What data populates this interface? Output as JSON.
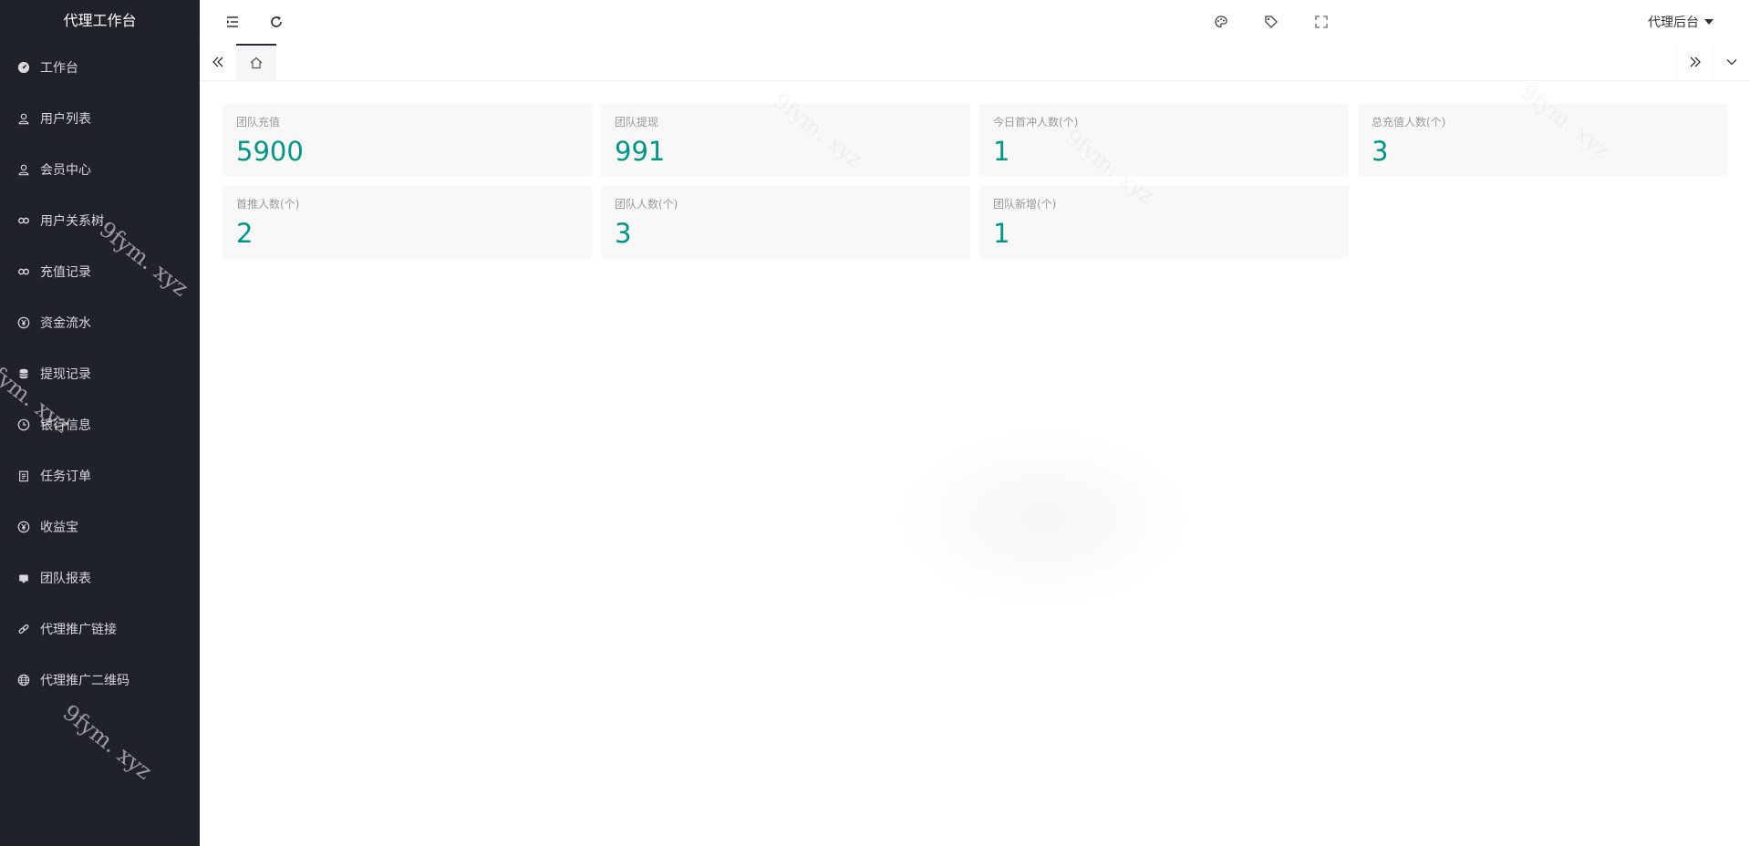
{
  "sidebar": {
    "title": "代理工作台",
    "items": [
      {
        "label": "工作台",
        "icon": "dashboard-icon"
      },
      {
        "label": "用户列表",
        "icon": "user-icon"
      },
      {
        "label": "会员中心",
        "icon": "user-icon"
      },
      {
        "label": "用户关系树",
        "icon": "link-chain-icon"
      },
      {
        "label": "充值记录",
        "icon": "link-chain-icon"
      },
      {
        "label": "资金流水",
        "icon": "yen-circle-icon"
      },
      {
        "label": "提现记录",
        "icon": "database-icon"
      },
      {
        "label": "银行信息",
        "icon": "clock-icon"
      },
      {
        "label": "任务订单",
        "icon": "clipboard-icon"
      },
      {
        "label": "收益宝",
        "icon": "yen-circle-icon"
      },
      {
        "label": "团队报表",
        "icon": "report-icon"
      },
      {
        "label": "代理推广链接",
        "icon": "link-icon"
      },
      {
        "label": "代理推广二维码",
        "icon": "globe-icon"
      }
    ]
  },
  "header": {
    "user_menu_label": "代理后台"
  },
  "stats": [
    {
      "label": "团队充值",
      "value": "5900"
    },
    {
      "label": "团队提现",
      "value": "991"
    },
    {
      "label": "今日首冲人数(个)",
      "value": "1"
    },
    {
      "label": "总充值人数(个)",
      "value": "3"
    },
    {
      "label": "首推人数(个)",
      "value": "2"
    },
    {
      "label": "团队人数(个)",
      "value": "3"
    },
    {
      "label": "团队新增(个)",
      "value": "1"
    }
  ],
  "watermark": "9fym. xyz",
  "colors": {
    "sidebar_bg": "#20222a",
    "accent": "#009688",
    "card_bg": "#f8f8f8"
  }
}
